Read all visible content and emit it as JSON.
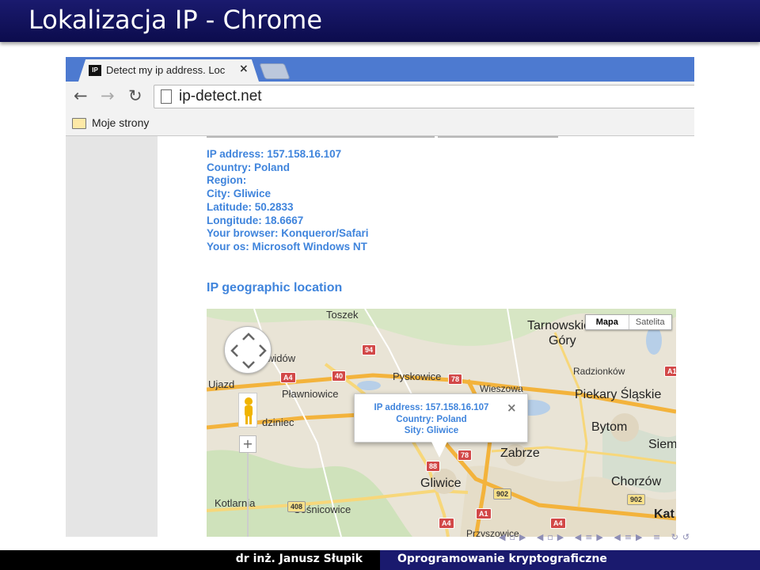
{
  "slide": {
    "title": "Lokalizacja IP - Chrome",
    "footer_author": "dr inż. Janusz Słupik",
    "footer_course": "Oprogramowanie kryptograficzne"
  },
  "browser": {
    "tab_title": "Detect my ip address. Loc",
    "tab_favicon_text": "IP",
    "tab_close": "×",
    "url": "ip-detect.net",
    "bookmark_folder": "Moje strony"
  },
  "page": {
    "info_lines": [
      "IP address: 157.158.16.107",
      "Country: Poland",
      "Region:",
      "City: Gliwice",
      "Latitude: 50.2833",
      "Longitude: 18.6667",
      "Your browser: Konqueror/Safari",
      "Your os: Microsoft Windows NT"
    ],
    "geo_heading": "IP geographic location"
  },
  "map": {
    "type_buttons": [
      "Mapa",
      "Satelita"
    ],
    "active_type": "Mapa",
    "bubble_lines": [
      "IP address: 157.158.16.107",
      "Country: Poland",
      "Sity: Gliwice"
    ],
    "bubble_close": "×",
    "zoom_in": "+",
    "places": [
      "Toszek",
      "Tarnowskie",
      "Góry",
      "Radzionków",
      "Piekary Śląskie",
      "Pyskowice",
      "Wieszowa",
      "Pławniowice",
      "Ujazd",
      "widów",
      "dziniec",
      "Bytom",
      "Zabrze",
      "Gliwice",
      "Chorzów",
      "Kotlarnia",
      "Sośnicowice",
      "Przyszowice",
      "Siem",
      "Kat"
    ],
    "road_numbers": [
      "94",
      "A4",
      "40",
      "78",
      "88",
      "78",
      "902",
      "A1",
      "408",
      "902",
      "A4",
      "A1",
      "A4"
    ]
  },
  "colors": {
    "title_bar": "#1a1a6e",
    "tabstrip": "#4d7ad0",
    "link_blue": "#3f84dc",
    "road_orange": "#f3b33c",
    "footer_left": "#000000",
    "footer_right": "#1a1a6e"
  }
}
